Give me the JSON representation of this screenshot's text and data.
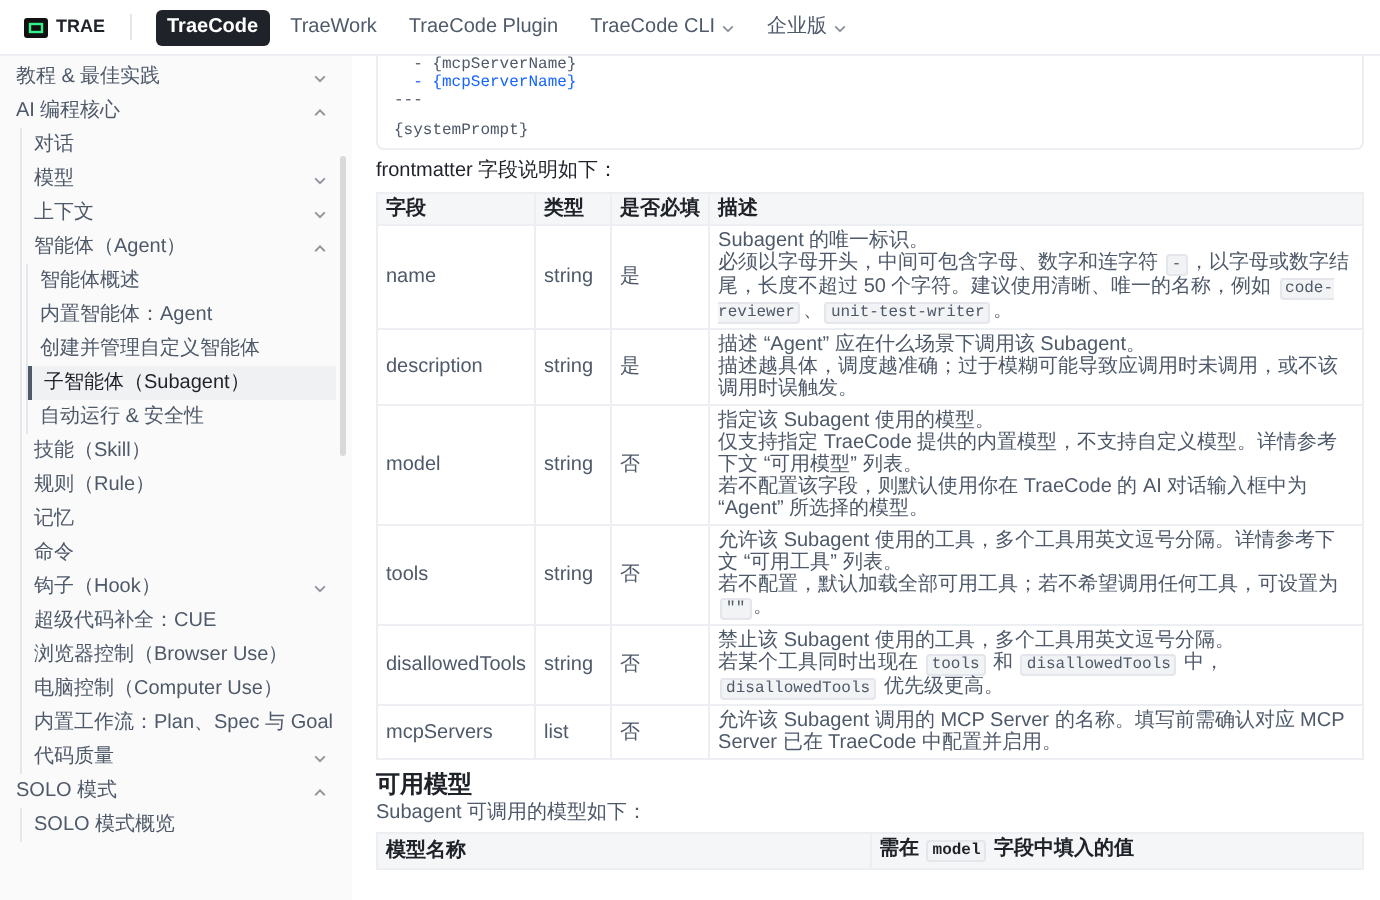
{
  "header": {
    "logo": "TRAE",
    "tabs": [
      {
        "label": "TraeCode",
        "selected": true
      },
      {
        "label": "TraeWork",
        "selected": false
      },
      {
        "label": "TraeCode Plugin",
        "selected": false
      },
      {
        "label": "TraeCode CLI",
        "selected": false,
        "dropdown": true
      },
      {
        "label": "企业版",
        "selected": false,
        "dropdown": true
      }
    ]
  },
  "sidebar": {
    "items": [
      {
        "label": "教程 & 最佳实践",
        "expanded": false,
        "selected": false
      },
      {
        "label": "AI 编程核心",
        "expanded": true,
        "selected": false,
        "children": [
          {
            "label": "对话",
            "selected": false
          },
          {
            "label": "模型",
            "expanded": false,
            "selected": false
          },
          {
            "label": "上下文",
            "expanded": false,
            "selected": false
          },
          {
            "label": "智能体（Agent）",
            "expanded": true,
            "selected": false,
            "children": [
              {
                "label": "智能体概述",
                "selected": false
              },
              {
                "label": "内置智能体：Agent",
                "selected": false
              },
              {
                "label": "创建并管理自定义智能体",
                "selected": false
              },
              {
                "label": "子智能体（Subagent）",
                "selected": true
              },
              {
                "label": "自动运行 & 安全性",
                "selected": false
              }
            ]
          },
          {
            "label": "技能（Skill）",
            "selected": false
          },
          {
            "label": "规则（Rule）",
            "selected": false
          },
          {
            "label": "记忆",
            "selected": false
          },
          {
            "label": "命令",
            "selected": false
          },
          {
            "label": "钩子（Hook）",
            "expanded": false,
            "selected": false
          },
          {
            "label": "超级代码补全：CUE",
            "selected": false
          },
          {
            "label": "浏览器控制（Browser Use）",
            "selected": false
          },
          {
            "label": "电脑控制（Computer Use）",
            "selected": false
          },
          {
            "label": "内置工作流：Plan、Spec 与 Goal",
            "selected": false
          },
          {
            "label": "代码质量",
            "expanded": false,
            "selected": false
          }
        ]
      },
      {
        "label": "SOLO 模式",
        "expanded": true,
        "selected": false,
        "children": [
          {
            "label": "SOLO 模式概览",
            "selected": false
          }
        ]
      }
    ]
  },
  "code_block": {
    "lines": [
      {
        "text": "  - {mcpServerName}",
        "highlighted": false,
        "kind": "yaml"
      },
      {
        "text": "  - {mcpServerName}",
        "highlighted": true,
        "kind": "yaml"
      },
      {
        "text": "---",
        "highlighted": false,
        "kind": "yaml"
      },
      {
        "text": "{systemPrompt}",
        "highlighted": false,
        "kind": "prompt"
      }
    ]
  },
  "intro": "frontmatter 字段说明如下：",
  "fields_table": {
    "columns": [
      "字段",
      "类型",
      "是否必填",
      "描述"
    ],
    "rows": [
      {
        "field": "name",
        "type": "string",
        "required": "是",
        "description": [
          [
            {
              "text": "Subagent 的唯一标识。",
              "code": false
            }
          ],
          [
            {
              "text": "必须以字母开头，中间可包含字母、数字和连字符 ",
              "code": false
            },
            {
              "text": "-",
              "code": true
            },
            {
              "text": "，以字母或数字结尾，长度不超过 50 个字符。建议使用清晰、唯一的名称，例如 ",
              "code": false
            },
            {
              "text": "code-reviewer",
              "code": true
            },
            {
              "text": "、",
              "code": false
            },
            {
              "text": "unit-test-writer",
              "code": true
            },
            {
              "text": "。",
              "code": false
            }
          ]
        ]
      },
      {
        "field": "description",
        "type": "string",
        "required": "是",
        "description": [
          [
            {
              "text": "描述 “Agent” 应在什么场景下调用该 Subagent。",
              "code": false
            }
          ],
          [
            {
              "text": "描述越具体，调度越准确；过于模糊可能导致应调用时未调用，或不该调用时误触发。",
              "code": false
            }
          ]
        ]
      },
      {
        "field": "model",
        "type": "string",
        "required": "否",
        "description": [
          [
            {
              "text": "指定该 Subagent 使用的模型。",
              "code": false
            }
          ],
          [
            {
              "text": "仅支持指定 TraeCode 提供的内置模型，不支持自定义模型。详情参考下文 “可用模型” 列表。",
              "code": false
            }
          ],
          [
            {
              "text": "若不配置该字段，则默认使用你在 TraeCode 的 AI 对话输入框中为 “Agent” 所选择的模型。",
              "code": false
            }
          ]
        ]
      },
      {
        "field": "tools",
        "type": "string",
        "required": "否",
        "description": [
          [
            {
              "text": "允许该 Subagent 使用的工具，多个工具用英文逗号分隔。详情参考下文 “可用工具” 列表。",
              "code": false
            }
          ],
          [
            {
              "text": "若不配置，默认加载全部可用工具；若不希望调用任何工具，可设置为 ",
              "code": false
            },
            {
              "text": "\"\"",
              "code": true
            },
            {
              "text": "。",
              "code": false
            }
          ]
        ]
      },
      {
        "field": "disallowedTools",
        "type": "string",
        "required": "否",
        "description": [
          [
            {
              "text": "禁止该 Subagent 使用的工具，多个工具用英文逗号分隔。",
              "code": false
            }
          ],
          [
            {
              "text": "若某个工具同时出现在 ",
              "code": false
            },
            {
              "text": "tools",
              "code": true
            },
            {
              "text": " 和 ",
              "code": false
            },
            {
              "text": "disallowedTools",
              "code": true
            },
            {
              "text": " 中，",
              "code": false
            },
            {
              "text": "disallowedTools",
              "code": true
            },
            {
              "text": " 优先级更高。",
              "code": false
            }
          ]
        ]
      },
      {
        "field": "mcpServers",
        "type": "list",
        "required": "否",
        "description": [
          [
            {
              "text": "允许该 Subagent 调用的 MCP Server 的名称。填写前需确认对应 MCP Server 已在 TraeCode 中配置并启用。",
              "code": false
            }
          ]
        ]
      }
    ]
  },
  "models_section": {
    "heading": "可用模型",
    "intro": "Subagent 可调用的模型如下：",
    "columns": [
      [
        {
          "text": "模型名称",
          "code": false
        }
      ],
      [
        {
          "text": "需在 ",
          "code": false
        },
        {
          "text": "model",
          "code": true
        },
        {
          "text": " 字段中填入的值",
          "code": false
        }
      ]
    ]
  }
}
